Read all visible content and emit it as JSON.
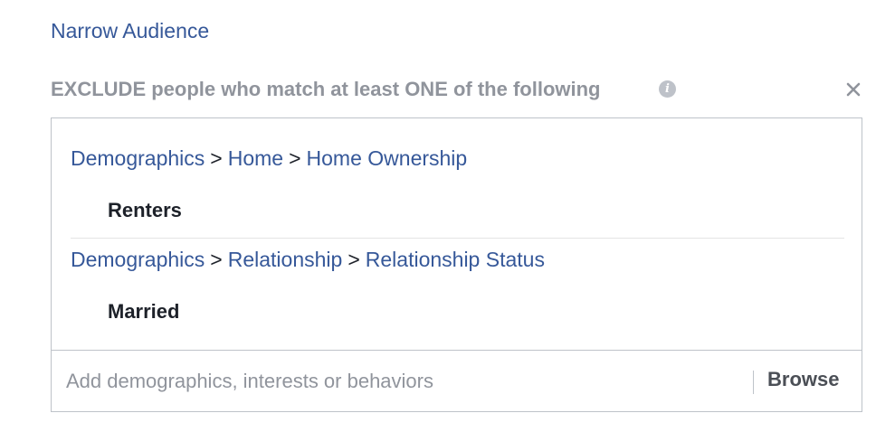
{
  "narrow_audience": {
    "label": "Narrow Audience"
  },
  "exclude_section": {
    "title": "EXCLUDE people who match at least ONE of the following",
    "info_icon": "info-icon",
    "info_glyph": "i",
    "close_icon": "close-icon",
    "groups": [
      {
        "breadcrumb": [
          "Demographics",
          "Home",
          "Home Ownership"
        ],
        "separator": ">",
        "selected": "Renters"
      },
      {
        "breadcrumb": [
          "Demographics",
          "Relationship",
          "Relationship Status"
        ],
        "separator": ">",
        "selected": "Married"
      }
    ],
    "search": {
      "placeholder": "Add demographics, interests or behaviors",
      "value": ""
    },
    "browse_label": "Browse"
  },
  "colors": {
    "link": "#365899",
    "muted_text": "#90949c",
    "border": "#bec3c9",
    "text": "#1d2129"
  }
}
